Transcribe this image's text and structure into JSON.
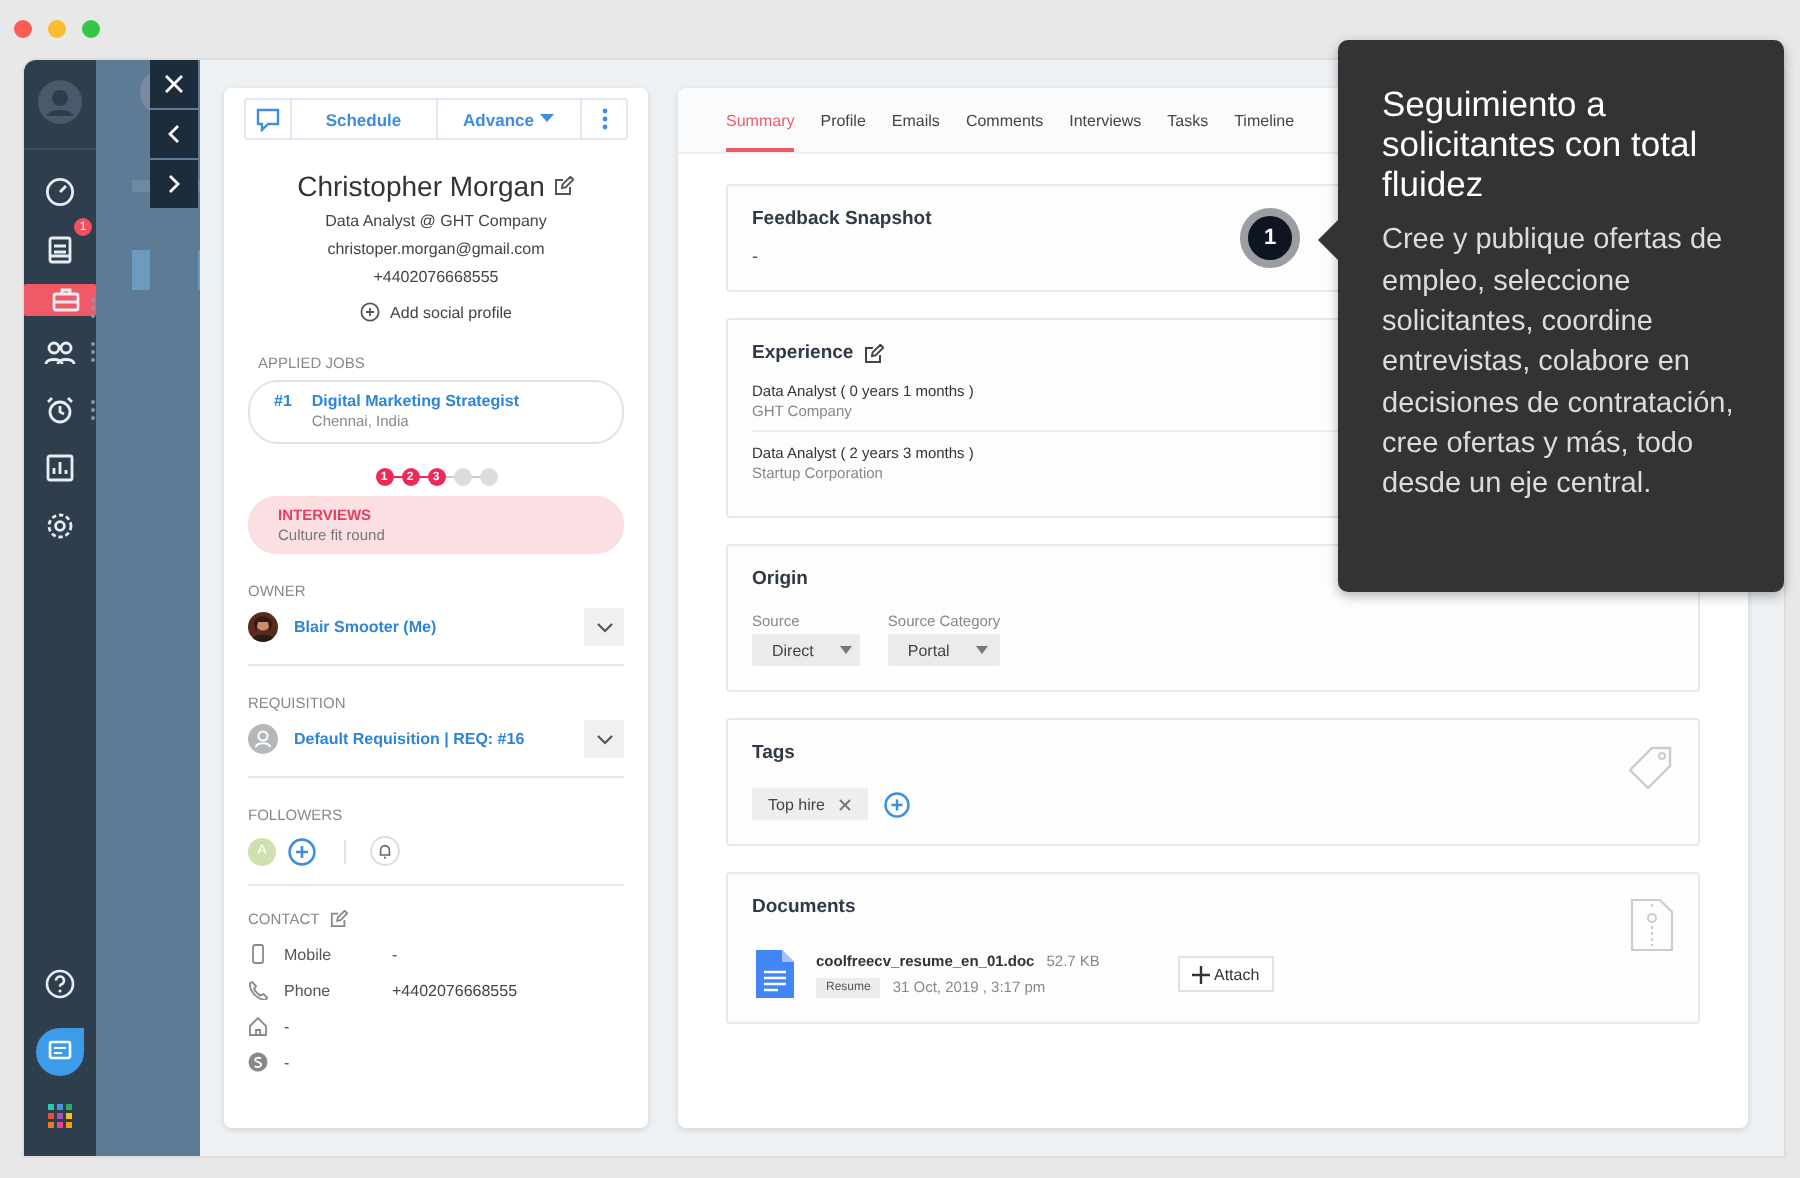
{
  "sidebar": {
    "items": [
      {
        "kind": "dashboard",
        "selected": false,
        "menu": false
      },
      {
        "kind": "inbox",
        "selected": false,
        "menu": false,
        "badge": "1"
      },
      {
        "kind": "jobs",
        "selected": true,
        "menu": true
      },
      {
        "kind": "contacts",
        "selected": false,
        "menu": true
      },
      {
        "kind": "alarm",
        "selected": false,
        "menu": true
      },
      {
        "kind": "reports",
        "selected": false,
        "menu": false
      },
      {
        "kind": "settings",
        "selected": false,
        "menu": false
      }
    ],
    "bottom": [
      {
        "kind": "help"
      },
      {
        "kind": "chat"
      },
      {
        "kind": "apps"
      }
    ]
  },
  "nav_buttons": [
    {
      "kind": "close"
    },
    {
      "kind": "previous"
    },
    {
      "kind": "next"
    }
  ],
  "toolbar": {
    "buttons": [
      {
        "kind": "feedback"
      },
      {
        "kind": "text",
        "label": "Schedule"
      },
      {
        "kind": "dropdown",
        "label": "Advance"
      },
      {
        "kind": "more"
      }
    ]
  },
  "candidate": {
    "name": "Christopher Morgan",
    "headline": "Data Analyst @ GHT Company",
    "email": "christoper.morgan@gmail.com",
    "phone": "+4402076668555",
    "add_social": "Add social profile"
  },
  "applied_jobs": {
    "label": "APPLIED JOBS",
    "jobs": [
      {
        "number": "#1",
        "title": "Digital Marketing Strategist",
        "location": "Chennai, India"
      }
    ]
  },
  "stages": [
    {
      "label": "1",
      "done": true
    },
    {
      "label": "2",
      "done": true
    },
    {
      "label": "3",
      "done": true
    },
    {
      "done": false
    },
    {
      "done": false
    }
  ],
  "stage_card": {
    "title": "INTERVIEWS",
    "subtitle": "Culture fit round"
  },
  "owner": {
    "label": "OWNER",
    "name": "Blair Smooter (Me)"
  },
  "requisition": {
    "label": "REQUISITION",
    "name": "Default Requisition | REQ: #16"
  },
  "followers": {
    "label": "FOLLOWERS",
    "avatars": [
      "A"
    ]
  },
  "contact": {
    "label": "CONTACT",
    "rows": [
      {
        "kind": "mobile",
        "label": "Mobile",
        "value": "-"
      },
      {
        "kind": "phone",
        "label": "Phone",
        "value": "+4402076668555"
      },
      {
        "kind": "home",
        "value": "-"
      },
      {
        "kind": "skype",
        "value": "-"
      }
    ]
  },
  "tabs": [
    {
      "label": "Summary",
      "selected": true
    },
    {
      "label": "Profile",
      "selected": false
    },
    {
      "label": "Emails",
      "selected": false
    },
    {
      "label": "Comments",
      "selected": false
    },
    {
      "label": "Interviews",
      "selected": false
    },
    {
      "label": "Tasks",
      "selected": false
    },
    {
      "label": "Timeline",
      "selected": false
    }
  ],
  "feedback": {
    "title": "Feedback Snapshot",
    "value": "-"
  },
  "experience": {
    "title": "Experience",
    "entries": [
      {
        "role": "Data Analyst ( 0 years 1 months )",
        "company": "GHT Company"
      },
      {
        "role": "Data Analyst ( 2 years 3 months )",
        "company": "Startup Corporation"
      }
    ]
  },
  "origin": {
    "title": "Origin",
    "fields": [
      {
        "label": "Source",
        "value": "Direct"
      },
      {
        "label": "Source Category",
        "value": "Portal"
      }
    ]
  },
  "tags": {
    "title": "Tags",
    "items": [
      "Top hire"
    ]
  },
  "documents": {
    "title": "Documents",
    "files": [
      {
        "name": "coolfreecv_resume_en_01.doc",
        "size": "52.7 KB",
        "tag": "Resume",
        "date": "31 Oct, 2019 , 3:17 pm"
      }
    ],
    "attach": "Attach"
  },
  "tooltip": {
    "marker": "1",
    "title": "Seguimiento a solicitantes con total fluidez",
    "body": "Cree y publique ofertas de empleo, seleccione solicitantes, coordine entrevistas, colabore en decisiones de contratación, cree ofertas y más, todo desde un eje central."
  }
}
